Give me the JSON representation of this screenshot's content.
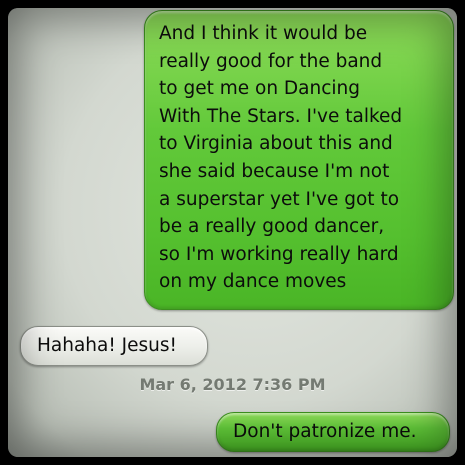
{
  "conversation": {
    "messages": [
      {
        "direction": "sent",
        "text": "And I think it would be\nreally good for the band\nto get me on Dancing\nWith The Stars. I've talked\nto Virginia about this and\nshe said because I'm not\na superstar yet I've got to\nbe a really good dancer,\nso I'm working really hard\non my dance moves"
      },
      {
        "direction": "received",
        "text": "Hahaha! Jesus!"
      },
      {
        "direction": "sent",
        "text": "Don't patronize me."
      }
    ],
    "timestamp": "Mar 6, 2012 7:36 PM"
  },
  "colors": {
    "sent_bubble": "#5cc535",
    "received_bubble": "#eceee9",
    "background": "#d8dcd5",
    "timestamp": "#747a72"
  }
}
